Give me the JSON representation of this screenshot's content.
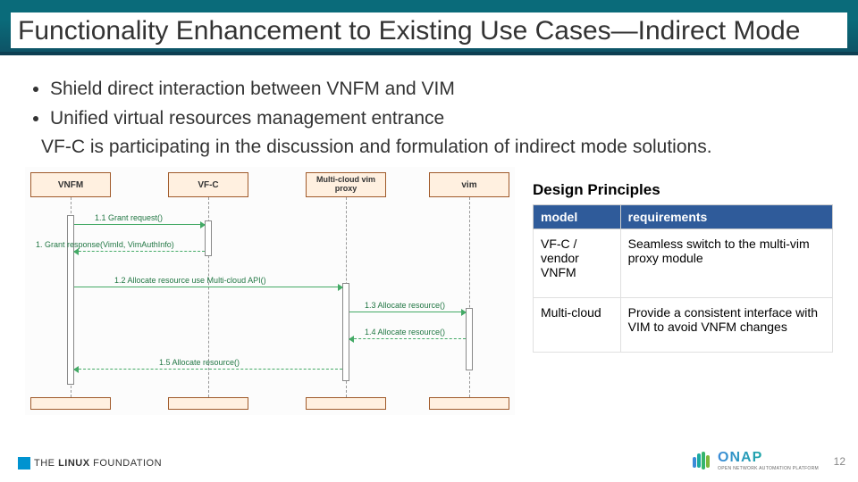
{
  "title": "Functionality Enhancement to Existing Use Cases—Indirect Mode",
  "bullets": [
    "Shield direct interaction between VNFM and VIM",
    "Unified virtual resources management entrance"
  ],
  "note": "VF-C is participating in the discussion and formulation of indirect mode solutions.",
  "diagram": {
    "lifelines": [
      "VNFM",
      "VF-C",
      "Multi-cloud vim proxy",
      "vim"
    ],
    "messages": [
      "1.1 Grant request()",
      "1. Grant response(VimId, VimAuthInfo)",
      "1.2 Allocate resource use Multi-cloud API()",
      "1.3 Allocate resource()",
      "1.4 Allocate resource()",
      "1.5 Allocate resource()"
    ]
  },
  "design_principles_title": "Design Principles",
  "table": {
    "headers": [
      "model",
      "requirements"
    ],
    "rows": [
      {
        "model": "VF-C / vendor VNFM",
        "req": "Seamless switch to the multi-vim proxy module"
      },
      {
        "model": "Multi-cloud",
        "req": "Provide a consistent interface with VIM  to avoid VNFM changes"
      }
    ]
  },
  "footer": {
    "linux": "THE LINUX FOUNDATION",
    "onap": "ONAP",
    "onap_sub": "OPEN NETWORK AUTOMATION PLATFORM",
    "page": "12"
  }
}
